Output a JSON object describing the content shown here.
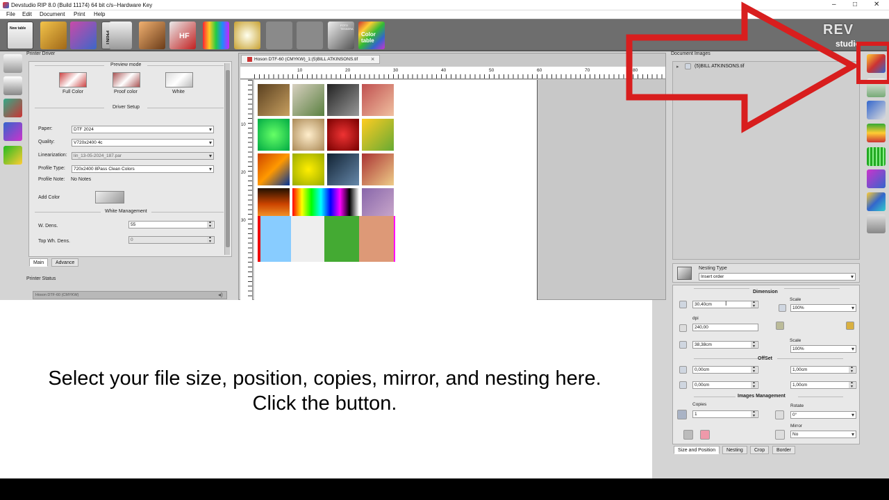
{
  "window": {
    "title": "Devstudio RIP 8.0 (Build 11174) 64 bit c/s--Hardware Key",
    "minimize": "–",
    "maximize": "□",
    "close": "✕"
  },
  "menu": [
    "File",
    "Edit",
    "Document",
    "Print",
    "Help"
  ],
  "toolbar": {
    "new_table": "New table",
    "print": "PRINT",
    "hf": "HF",
    "photo_id": "FOTO TESSERA",
    "color_table": "Color table"
  },
  "left_panel": {
    "title": "Printer Driver",
    "preview_mode": "Preview mode",
    "preview_options": [
      "Full Color",
      "Proof color",
      "White"
    ],
    "driver_setup": "Driver Setup",
    "paper_label": "Paper:",
    "paper_value": "DTF 2024",
    "quality_label": "Quality:",
    "quality_value": "V720x2400  4c",
    "linearization_label": "Linearization:",
    "linearization_value": "lin_13-05-2024_187.par",
    "profile_type_label": "Profile Type:",
    "profile_type_value": "720x2400 8Pass Clean Colors",
    "profile_note_label": "Profile Note:",
    "profile_note_value": "No Notes",
    "add_color_label": "Add Color",
    "white_management": "White Management",
    "w_dens_label": "W. Dens.",
    "w_dens_value": "55",
    "top_wh_dens_label": "Top Wh. Dens.",
    "top_wh_dens_value": "0",
    "tabs": [
      "Main",
      "Advance"
    ],
    "printer_status": "Printer Status",
    "printer_name": "Hoson DTF-60 (CMYKW)"
  },
  "document": {
    "tab_label": "Hoson DTF-60 (CMYKW)_1:(5)BILL ATKINSONS.tif",
    "tab_close": "×",
    "ruler_marks": [
      "10",
      "20",
      "30",
      "40",
      "50",
      "60",
      "70",
      "80"
    ],
    "vruler_marks": [
      "10",
      "20",
      "30"
    ]
  },
  "right_panel": {
    "document_images": "Document Images",
    "tree_item": "(5)BILL ATKINSONS.tif",
    "tree_expand": "▸",
    "nesting_type_label": "Nesting Type",
    "nesting_type_value": "Insert order",
    "dimension": "Dimension",
    "width": "30,40cm",
    "scale_label": "Scale",
    "scale_w": "100%",
    "dpi_label": "dpi",
    "dpi": "240,00",
    "height": "38,38cm",
    "scale_h": "100%",
    "offset": "OffSet",
    "offset_x1": "0,00cm",
    "offset_y1": "0,00cm",
    "offset_x2": "1,00cm",
    "offset_y2": "1,00cm",
    "images_management": "Images Management",
    "copies_label": "Copies",
    "copies": "1",
    "rotate_label": "Rotate",
    "rotate": "0°",
    "mirror_label": "Mirror",
    "mirror": "No",
    "tabs": [
      "Size and Position",
      "Nesting",
      "Crop",
      "Border"
    ]
  },
  "logo": {
    "text": "REV",
    "sub": "studio"
  },
  "caption": "Select your file size, position, copies, mirror, and nesting here.  Click the button.",
  "colors": {
    "arrow_red": "#d81e1e",
    "toolbar_bg": "#6e6e6e",
    "overlay_bg": "#ffffff"
  },
  "icons": [
    "new-table-icon",
    "open-icon",
    "save-icon",
    "print-icon",
    "printer-icon",
    "photo-icon",
    "hf-icon",
    "color-bars-icon",
    "tools-icon",
    "camera-icon",
    "power-icon",
    "photo-id-icon",
    "color-table-icon"
  ]
}
